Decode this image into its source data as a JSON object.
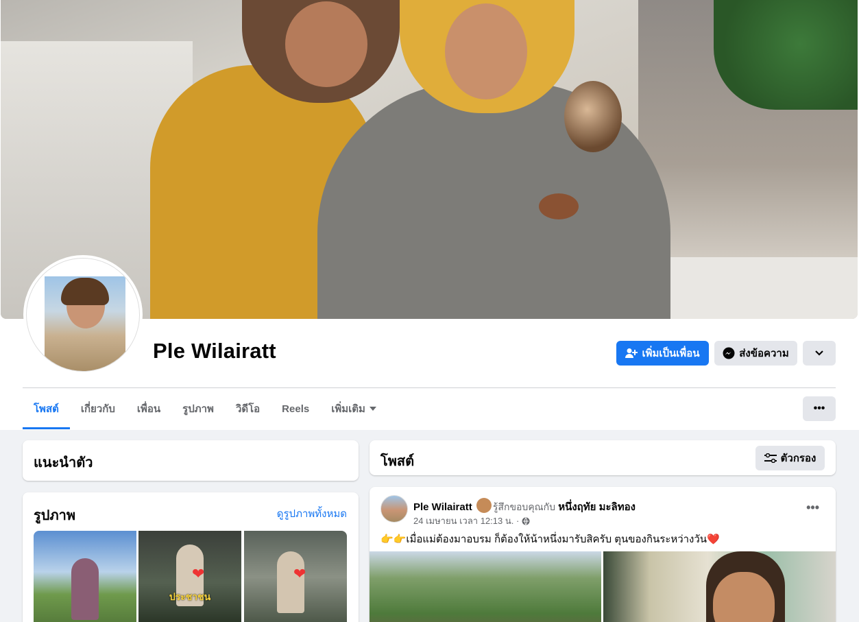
{
  "profile": {
    "name": "Ple Wilairatt"
  },
  "actions": {
    "add_friend": "เพิ่มเป็นเพื่อน",
    "message": "ส่งข้อความ"
  },
  "tabs": [
    {
      "label": "โพสต์",
      "active": true
    },
    {
      "label": "เกี่ยวกับ"
    },
    {
      "label": "เพื่อน"
    },
    {
      "label": "รูปภาพ"
    },
    {
      "label": "วิดีโอ"
    },
    {
      "label": "Reels"
    },
    {
      "label": "เพิ่มเติม"
    }
  ],
  "intro": {
    "title": "แนะนำตัว"
  },
  "photos": {
    "title": "รูปภาพ",
    "see_all": "ดูรูปภาพทั้งหมด",
    "thumb2_caption": "ประชาชน"
  },
  "posts": {
    "title": "โพสต์",
    "filter": "ตัวกรอง"
  },
  "post": {
    "author": "Ple Wilairatt",
    "feeling": "รู้สึกขอบคุณกับ",
    "tagged": "หนึ่งฤทัย มะลิทอง",
    "timestamp": "24 เมษายน เวลา 12:13 น. ·",
    "text": "👉👉เมื่อแม่ต้องมาอบรม ก็ต้องให้น้าหนึ่งมารับสิครับ ตุนของกินระหว่างวัน❤️"
  },
  "colors": {
    "accent": "#1877f2",
    "secondary_button": "#e4e6eb",
    "background": "#f0f2f5"
  }
}
